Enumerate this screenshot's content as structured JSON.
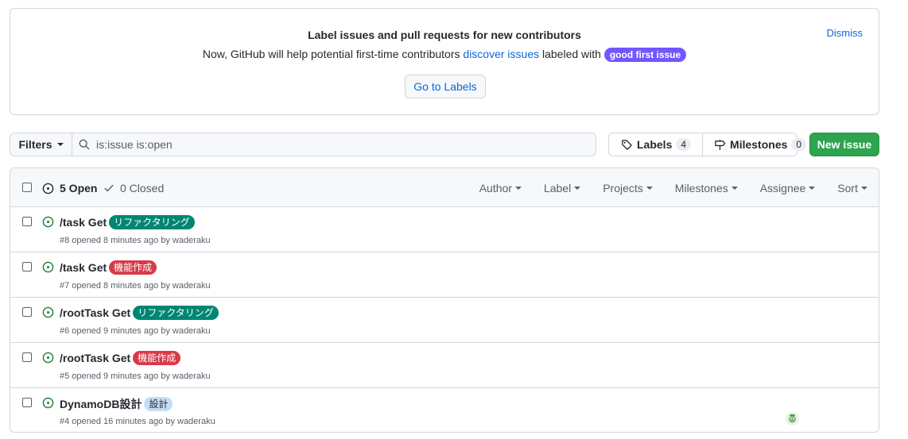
{
  "banner": {
    "title": "Label issues and pull requests for new contributors",
    "text_before": "Now, GitHub will help potential first-time contributors",
    "link": "discover issues",
    "text_after": "labeled with",
    "badge": "good first issue",
    "dismiss": "Dismiss",
    "button": "Go to Labels"
  },
  "toolbar": {
    "filters_label": "Filters",
    "search_value": "is:issue is:open",
    "labels_label": "Labels",
    "labels_count": "4",
    "milestones_label": "Milestones",
    "milestones_count": "0",
    "new_issue": "New issue"
  },
  "list_header": {
    "open": "5 Open",
    "closed": "0 Closed",
    "filters": [
      "Author",
      "Label",
      "Projects",
      "Milestones",
      "Assignee",
      "Sort"
    ]
  },
  "issues": [
    {
      "title": "/task Get",
      "label": "リファクタリング",
      "label_bg": "#008672",
      "label_fg": "#ffffff",
      "meta": "#8 opened 8 minutes ago by waderaku"
    },
    {
      "title": "/task Get",
      "label": "機能作成",
      "label_bg": "#d73a4a",
      "label_fg": "#ffffff",
      "meta": "#7 opened 8 minutes ago by waderaku"
    },
    {
      "title": "/rootTask Get",
      "label": "リファクタリング",
      "label_bg": "#008672",
      "label_fg": "#ffffff",
      "meta": "#6 opened 9 minutes ago by waderaku"
    },
    {
      "title": "/rootTask Get",
      "label": "機能作成",
      "label_bg": "#d73a4a",
      "label_fg": "#ffffff",
      "meta": "#5 opened 9 minutes ago by waderaku"
    },
    {
      "title": "DynamoDB設計",
      "label": "設計",
      "label_bg": "#c5def5",
      "label_fg": "#24292f",
      "meta": "#4 opened 16 minutes ago by waderaku",
      "has_assignee": true
    }
  ],
  "colors": {
    "accent": "#0969da",
    "open_green": "#1a7f37",
    "primary_button": "#2da44e"
  },
  "icons": {
    "search": "search-icon",
    "tag": "tag-icon",
    "milestone": "milestone-icon",
    "issue_open": "issue-opened-icon",
    "check": "check-icon"
  }
}
